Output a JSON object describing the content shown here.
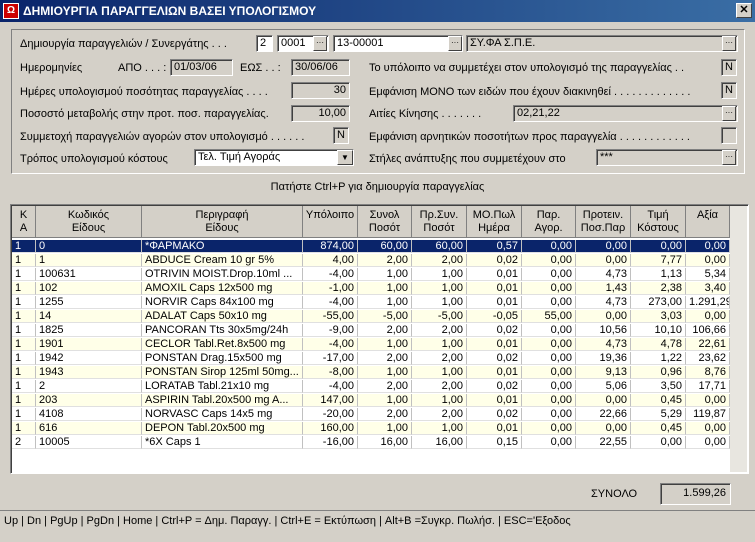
{
  "window": {
    "title": "ΔΗΜΙΟΥΡΓΙΑ ΠΑΡΑΓΓΕΛΙΩΝ ΒΑΣΕΙ ΥΠΟΛΟΓΙΣΜΟΥ",
    "close_glyph": "✕",
    "app_icon": "app-icon"
  },
  "form": {
    "supplier_label": "Δημιουργία παραγγελιών / Συνεργάτης . . .",
    "supplier_code1": "2",
    "supplier_code2": "0001",
    "supplier_code3": "13-00001",
    "supplier_name": "ΣΥ.ΦΑ Σ.Π.Ε.",
    "dates_label": "Ημερομηνίες",
    "from_label": "ΑΠΟ . . . :",
    "from_value": "01/03/06",
    "to_label": "ΕΩΣ . . :",
    "to_value": "30/06/06",
    "days_label": "Ημέρες υπολογισμού ποσότητας παραγγελίας . . . .",
    "days_value": "30",
    "percent_label": "Ποσοστό μεταβολής στην προτ. ποσ. παραγγελίας.",
    "percent_value": "10,00",
    "participation_label": "Συμμετοχή παραγγελιών αγορών στον υπολογισμό . . . . . .",
    "participation_value": "N",
    "cost_method_label": "Τρόπος υπολογισμού κόστους",
    "cost_method_value": "Τελ. Τιμή Αγοράς",
    "remainder_label": "Το υπόλοιπο να συμμετέχει στον υπολογισμό της παραγγελίας . .",
    "remainder_value": "N",
    "only_items_label": "Εμφάνιση ΜΟΝΟ των ειδών που έχουν διακινηθεί . . . . . . . . . . . . .",
    "only_items_value": "N",
    "causes_label": "Αιτίες Κίνησης . . . . . . .",
    "causes_value": "02,21,22",
    "negative_label": "Εμφάνιση αρνητικών ποσοτήτων προς παραγγελία . . . . . . . . . . . .",
    "negative_value": "",
    "columns_label": "Στήλες ανάπτυξης που συμμετέχουν στο",
    "columns_value": "***"
  },
  "hint": "Πατήστε Ctrl+P για δημιουργία παραγγελίας",
  "grid": {
    "headers": [
      [
        "Κ",
        "Α"
      ],
      [
        "Κωδικός",
        "Είδους"
      ],
      [
        "Περιγραφή",
        "Είδους"
      ],
      [
        "Υπόλοιπο",
        ""
      ],
      [
        "Συνολ",
        "Ποσότ"
      ],
      [
        "Πρ.Συν.",
        "Ποσότ"
      ],
      [
        "ΜΟ.Πωλ",
        "Ημέρα"
      ],
      [
        "Παρ.",
        "Αγορ."
      ],
      [
        "Προτειν.",
        "Ποσ.Παρ"
      ],
      [
        "Τιμή",
        "Κόστους"
      ],
      [
        "Αξία",
        ""
      ]
    ],
    "rows": [
      [
        "1",
        "0",
        "*ΦΑΡΜΑΚΟ",
        "874,00",
        "60,00",
        "60,00",
        "0,57",
        "0,00",
        "0,00",
        "0,00",
        "0,00"
      ],
      [
        "1",
        "1",
        "ABDUCE Cream 10 gr  5%",
        "4,00",
        "2,00",
        "2,00",
        "0,02",
        "0,00",
        "0,00",
        "7,77",
        "0,00"
      ],
      [
        "1",
        "100631",
        "OTRIVIN MOIST.Drop.10ml ...",
        "-4,00",
        "1,00",
        "1,00",
        "0,01",
        "0,00",
        "4,73",
        "1,13",
        "5,34"
      ],
      [
        "1",
        "102",
        "AMOXIL Caps 12x500 mg",
        "-1,00",
        "1,00",
        "1,00",
        "0,01",
        "0,00",
        "1,43",
        "2,38",
        "3,40"
      ],
      [
        "1",
        "1255",
        "NORVIR Caps 84x100 mg",
        "-4,00",
        "1,00",
        "1,00",
        "0,01",
        "0,00",
        "4,73",
        "273,00",
        "1.291,29"
      ],
      [
        "1",
        "14",
        "ADALAT Caps 50x10 mg",
        "-55,00",
        "-5,00",
        "-5,00",
        "-0,05",
        "55,00",
        "0,00",
        "3,03",
        "0,00"
      ],
      [
        "1",
        "1825",
        "PANCORAN  Tts 30x5mg/24h",
        "-9,00",
        "2,00",
        "2,00",
        "0,02",
        "0,00",
        "10,56",
        "10,10",
        "106,66"
      ],
      [
        "1",
        "1901",
        "CECLOR Tabl.Ret.8x500 mg",
        "-4,00",
        "1,00",
        "1,00",
        "0,01",
        "0,00",
        "4,73",
        "4,78",
        "22,61"
      ],
      [
        "1",
        "1942",
        "PONSTAN Drag.15x500 mg",
        "-17,00",
        "2,00",
        "2,00",
        "0,02",
        "0,00",
        "19,36",
        "1,22",
        "23,62"
      ],
      [
        "1",
        "1943",
        "PONSTAN Sirop 125ml 50mg...",
        "-8,00",
        "1,00",
        "1,00",
        "0,01",
        "0,00",
        "9,13",
        "0,96",
        "8,76"
      ],
      [
        "1",
        "2",
        "LORATAB Tabl.21x10 mg",
        "-4,00",
        "2,00",
        "2,00",
        "0,02",
        "0,00",
        "5,06",
        "3,50",
        "17,71"
      ],
      [
        "1",
        "203",
        "ASPIRIN  Tabl.20x500 mg A...",
        "147,00",
        "1,00",
        "1,00",
        "0,01",
        "0,00",
        "0,00",
        "0,45",
        "0,00"
      ],
      [
        "1",
        "4108",
        "NORVASC  Caps 14x5 mg",
        "-20,00",
        "2,00",
        "2,00",
        "0,02",
        "0,00",
        "22,66",
        "5,29",
        "119,87"
      ],
      [
        "1",
        "616",
        "DEPON  Tabl.20x500 mg",
        "160,00",
        "1,00",
        "1,00",
        "0,01",
        "0,00",
        "0,00",
        "0,45",
        "0,00"
      ],
      [
        "2",
        "10005",
        "*6X Caps          1",
        "-16,00",
        "16,00",
        "16,00",
        "0,15",
        "0,00",
        "22,55",
        "0,00",
        "0,00"
      ]
    ]
  },
  "total": {
    "label": "ΣΥΝΟΛΟ",
    "value": "1.599,26"
  },
  "status_bar": "Up | Dn | PgUp | PgDn | Home | Ctrl+P = Δημ. Παραγγ. | Ctrl+E = Εκτύπωση | Alt+B =Συγκρ. Πωλήσ. | ESC='Εξοδος"
}
